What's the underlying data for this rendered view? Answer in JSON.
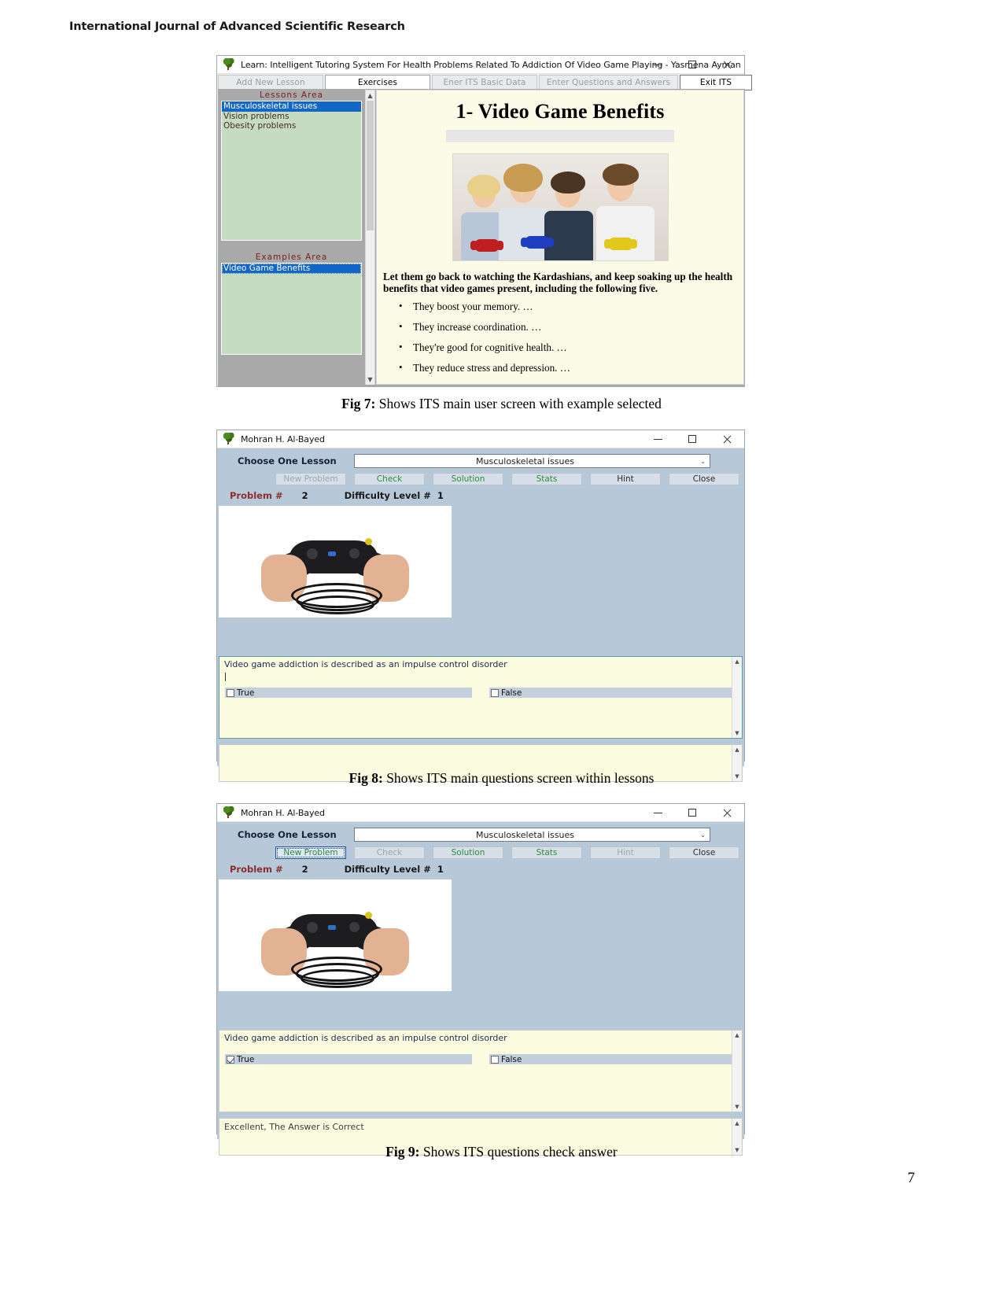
{
  "document": {
    "running_head": "International Journal of Advanced Scientific Research",
    "page_number": "7"
  },
  "captions": {
    "fig7_bold": "Fig 7:",
    "fig7_text": " Shows ITS main user screen with example selected",
    "fig8_bold": "Fig 8:",
    "fig8_text": " Shows ITS main questions screen within lessons",
    "fig9_bold": "Fig 9:",
    "fig9_text": " Shows ITS questions check answer"
  },
  "fig7": {
    "window_title": "Learn: Intelligent Tutoring System For Health Problems Related To Addiction Of Video Game Playing  - Yasmena Ayman",
    "titlebar_buttons": {
      "minimize": "—",
      "maximize": "□",
      "close": "✕"
    },
    "menu": [
      {
        "label": "Add New Lesson",
        "state": "disabled"
      },
      {
        "label": "Exercises",
        "state": "active"
      },
      {
        "label": "Ener ITS Basic Data",
        "state": "disabled"
      },
      {
        "label": "Enter Questions and Answers",
        "state": "disabled"
      },
      {
        "label": "Exit ITS",
        "state": "enabled"
      }
    ],
    "lessons_area": {
      "header": "Lessons  Area",
      "items": [
        "Musculoskeletal issues",
        "Vision problems",
        "Obesity problems"
      ],
      "selected_index": 0
    },
    "examples_area": {
      "header": "Examples  Area",
      "items": [
        "Video Game Benefits"
      ],
      "selected_index": 0
    },
    "slide": {
      "title": "1- Video Game Benefits",
      "lead": "Let them go back to watching the Kardashians, and keep soaking up the health benefits that video games present, including the following five.",
      "bullets": [
        "They boost your memory. …",
        "They increase coordination. …",
        "They're good for cognitive health. …",
        "They reduce stress and depression. …"
      ]
    }
  },
  "fig8": {
    "window_title": "Mohran H. Al-Bayed",
    "titlebar_buttons": {
      "minimize": "—",
      "maximize": "□",
      "close": "✕"
    },
    "lesson_label": "Choose One Lesson",
    "lesson_value": "Musculoskeletal issues",
    "dropdown_chevron": "⌄",
    "buttons": [
      {
        "label": "New Problem",
        "state": "disabled"
      },
      {
        "label": "Check",
        "state": "enabled"
      },
      {
        "label": "Solution",
        "state": "enabled"
      },
      {
        "label": "Stats",
        "state": "enabled"
      },
      {
        "label": "Hint",
        "state": "dark"
      },
      {
        "label": "Close",
        "state": "dark"
      }
    ],
    "problem_label": "Problem #",
    "problem_value": "2",
    "difficulty_label": "Difficulty Level #",
    "difficulty_value": "1",
    "question_text": "Video game addiction is described as an impulse control disorder",
    "choices": [
      {
        "label": "True",
        "checked": false
      },
      {
        "label": "False",
        "checked": false
      }
    ],
    "feedback_text": ""
  },
  "fig9": {
    "window_title": "Mohran H. Al-Bayed",
    "titlebar_buttons": {
      "minimize": "—",
      "maximize": "□",
      "close": "✕"
    },
    "lesson_label": "Choose One Lesson",
    "lesson_value": "Musculoskeletal issues",
    "dropdown_chevron": "⌄",
    "buttons": [
      {
        "label": "New Problem",
        "state": "focused"
      },
      {
        "label": "Check",
        "state": "disabled"
      },
      {
        "label": "Solution",
        "state": "enabled"
      },
      {
        "label": "Stats",
        "state": "enabled"
      },
      {
        "label": "Hint",
        "state": "disabled"
      },
      {
        "label": "Close",
        "state": "dark"
      }
    ],
    "problem_label": "Problem #",
    "problem_value": "2",
    "difficulty_label": "Difficulty Level #",
    "difficulty_value": "1",
    "question_text": "Video game addiction is described as an impulse control disorder",
    "choices": [
      {
        "label": "True",
        "checked": true
      },
      {
        "label": "False",
        "checked": false
      }
    ],
    "feedback_text": "Excellent, The Answer is Correct"
  },
  "colors": {
    "window_chrome": "#f0f0f0",
    "panel_blue": "#b7c9d8",
    "listbox_green": "#c5dcc3",
    "selection_blue": "#1266c6",
    "slide_cream": "#fbfbe8",
    "answer_cream": "#fbfbe0",
    "button_green_text": "#2f8a3f",
    "header_maroon": "#7a2020"
  }
}
